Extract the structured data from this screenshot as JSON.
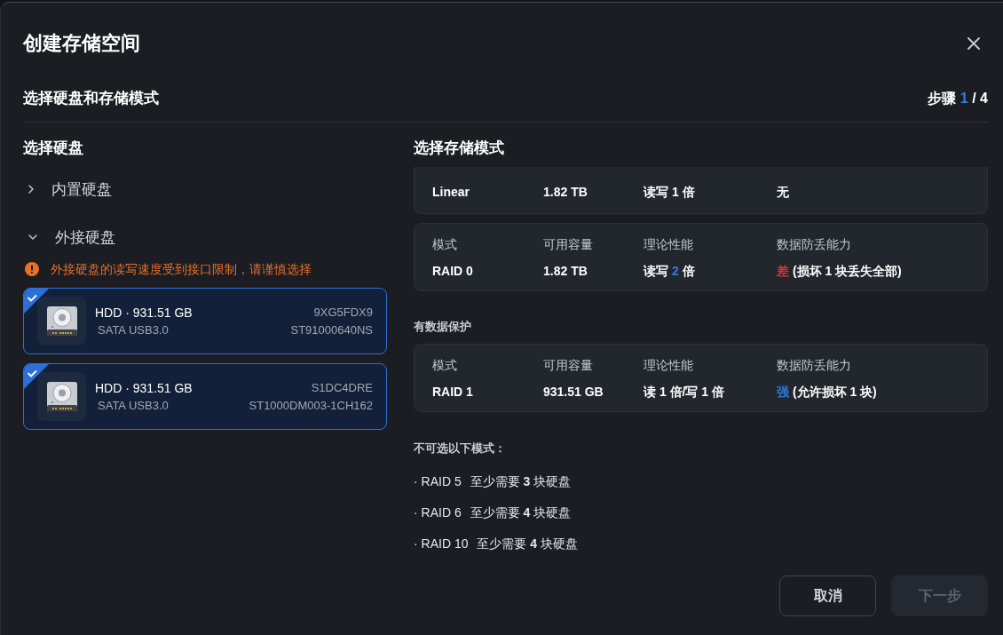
{
  "dialog": {
    "title": "创建存储空间"
  },
  "step": {
    "title": "选择硬盘和存储模式",
    "label": "步骤",
    "current": "1",
    "total_text": "/ 4"
  },
  "disk_panel": {
    "title": "选择硬盘",
    "groups": [
      {
        "name": "内置硬盘",
        "expanded": false
      },
      {
        "name": "外接硬盘",
        "expanded": true,
        "warning": "外接硬盘的读写速度受到接口限制，请谨慎选择",
        "disks": [
          {
            "name": "HDD · 931.51 GB",
            "interface": "SATA USB3.0",
            "serial": "9XG5FDX9",
            "model": "ST91000640NS",
            "selected": true
          },
          {
            "name": "HDD · 931.51 GB",
            "interface": "SATA USB3.0",
            "serial": "S1DC4DRE",
            "model": "ST1000DM003-1CH162",
            "selected": true
          }
        ]
      }
    ]
  },
  "mode_panel": {
    "title": "选择存储模式",
    "sections": [
      {
        "modes": [
          {
            "selected": false,
            "cut_top": true,
            "cells": [
              [
                {
                  "text": "Linear",
                  "kind": "plain"
                }
              ],
              [
                {
                  "text": "1.82 TB",
                  "kind": "plain"
                }
              ],
              [
                {
                  "text": "读写 1 倍",
                  "kind": "plain"
                }
              ],
              [
                {
                  "text": "无",
                  "kind": "plain"
                }
              ]
            ]
          },
          {
            "selected": false,
            "cut_top": false,
            "columns": [
              "模式",
              "可用容量",
              "理论性能",
              "数据防丢能力"
            ],
            "cells": [
              [
                {
                  "text": "RAID 0",
                  "kind": "plain"
                }
              ],
              [
                {
                  "text": "1.82 TB",
                  "kind": "plain"
                }
              ],
              [
                {
                  "text": "读写 ",
                  "kind": "plain"
                },
                {
                  "text": "2",
                  "kind": "accent"
                },
                {
                  "text": " 倍",
                  "kind": "plain"
                }
              ],
              [
                {
                  "text": "差",
                  "kind": "danger"
                },
                {
                  "text": " (损坏 1 块丢失全部)",
                  "kind": "plain"
                }
              ]
            ]
          }
        ]
      },
      {
        "heading": "有数据保护",
        "modes": [
          {
            "selected": false,
            "cut_top": false,
            "columns": [
              "模式",
              "可用容量",
              "理论性能",
              "数据防丢能力"
            ],
            "cells": [
              [
                {
                  "text": "RAID 1",
                  "kind": "plain"
                }
              ],
              [
                {
                  "text": "931.51 GB",
                  "kind": "plain"
                }
              ],
              [
                {
                  "text": "读 1 倍/写 1 倍",
                  "kind": "plain"
                }
              ],
              [
                {
                  "text": "强",
                  "kind": "accent"
                },
                {
                  "text": " (允许损坏 1 块)",
                  "kind": "plain"
                }
              ]
            ]
          }
        ]
      }
    ],
    "unavailable": {
      "title": "不可选以下模式：",
      "items": [
        {
          "mode": "· RAID 5",
          "requirement": "至少需要 **3** 块硬盘"
        },
        {
          "mode": "· RAID 6",
          "requirement": "至少需要 **4** 块硬盘"
        },
        {
          "mode": "· RAID 10",
          "requirement": "至少需要 **4** 块硬盘"
        }
      ]
    }
  },
  "buttons": [
    {
      "label": "取消",
      "kind": "secondary",
      "disabled": false
    },
    {
      "label": "下一步",
      "kind": "primary",
      "disabled": true
    }
  ]
}
